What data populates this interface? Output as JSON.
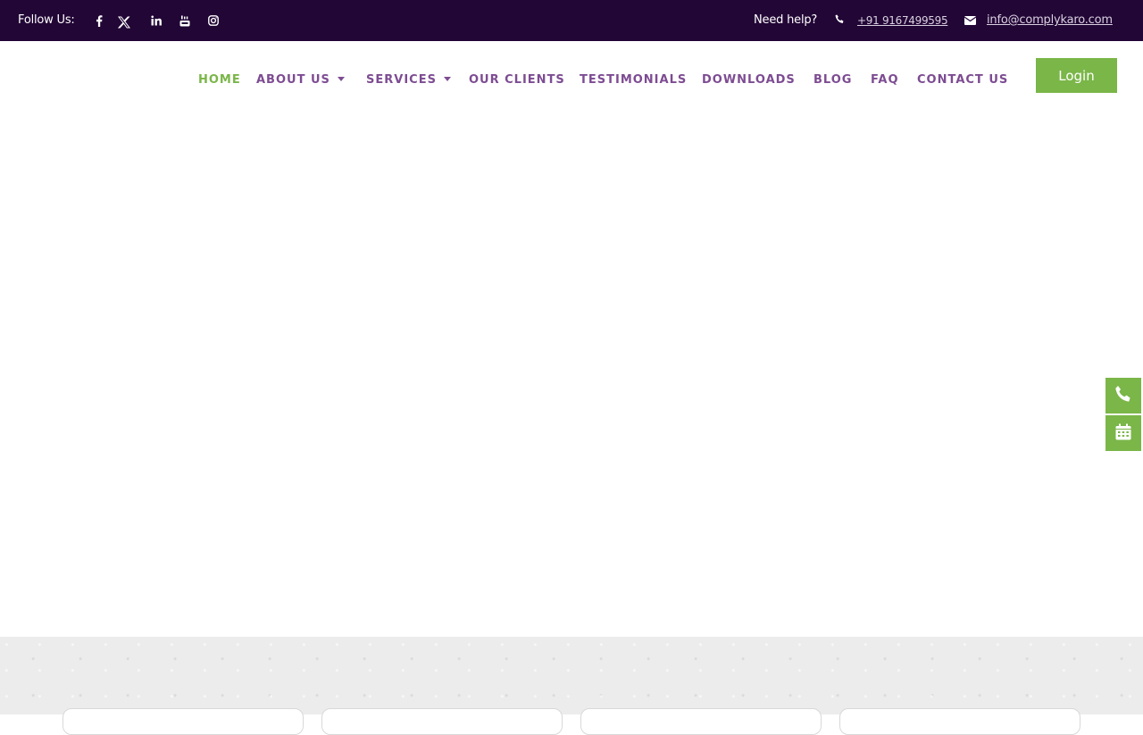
{
  "topbar": {
    "follow_label": "Follow Us:",
    "social": [
      "facebook-icon",
      "x-twitter-icon",
      "linkedin-icon",
      "youtube-icon",
      "instagram-icon"
    ],
    "help_label": "Need help?",
    "phone": "+91 9167499595",
    "email": "info@complykaro.com"
  },
  "nav": {
    "items": [
      {
        "label": "HOME",
        "active": true
      },
      {
        "label": "ABOUT US",
        "dropdown": true
      },
      {
        "label": "SERVICES",
        "dropdown": true
      },
      {
        "label": "OUR CLIENTS"
      },
      {
        "label": "TESTIMONIALS"
      },
      {
        "label": "DOWNLOADS"
      },
      {
        "label": "BLOG"
      },
      {
        "label": "FAQ"
      },
      {
        "label": "CONTACT US"
      }
    ],
    "login_label": "Login"
  },
  "floating": [
    "phone-icon",
    "calendar-icon"
  ],
  "colors": {
    "topbar_bg": "#220636",
    "accent_green": "#7ab648",
    "nav_purple": "#7d4c92"
  }
}
